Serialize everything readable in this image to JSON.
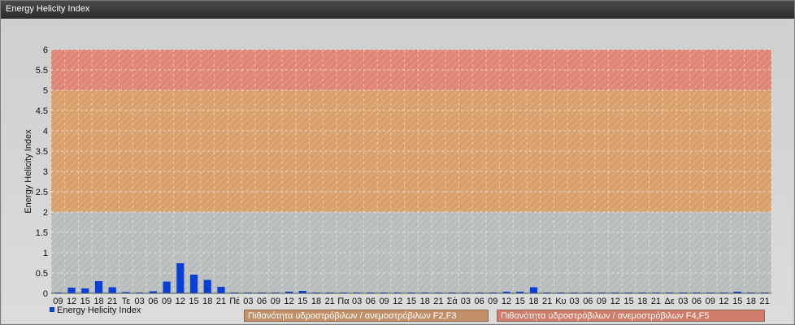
{
  "window": {
    "title": "Energy Helicity Index"
  },
  "colors": {
    "bar": "#0a3fd6",
    "band_low": "#b8bcbc",
    "band_mid": "#d9a06c",
    "band_high": "#de8574"
  },
  "chart_data": {
    "type": "bar",
    "ylabel": "Energy Helicity Index",
    "ylim": [
      0,
      6
    ],
    "yticks": [
      0,
      0.5,
      1,
      1.5,
      2,
      2.5,
      3,
      3.5,
      4,
      4.5,
      5,
      5.5,
      6
    ],
    "grid": true,
    "bands": [
      {
        "from": 2,
        "to": 5,
        "label": "Πιθανότητα υδροστρόβιλων / ανεμοστρόβιλων F2,F3"
      },
      {
        "from": 5,
        "to": 6,
        "label": "Πιθανότητα υδροστρόβιλων / ανεμοστρόβιλων F4,F5"
      }
    ],
    "categories": [
      "09",
      "12",
      "15",
      "18",
      "21",
      "Τε",
      "03",
      "06",
      "09",
      "12",
      "15",
      "18",
      "21",
      "Πέ",
      "03",
      "06",
      "09",
      "12",
      "15",
      "18",
      "21",
      "Πα",
      "03",
      "06",
      "09",
      "12",
      "15",
      "18",
      "21",
      "Σά",
      "03",
      "06",
      "09",
      "12",
      "15",
      "18",
      "21",
      "Κυ",
      "03",
      "06",
      "09",
      "12",
      "15",
      "18",
      "21",
      "Δε",
      "03",
      "06",
      "09",
      "12",
      "15",
      "18",
      "21"
    ],
    "series": [
      {
        "name": "Energy Helicity Index",
        "values": [
          0.01,
          0.14,
          0.12,
          0.3,
          0.15,
          0.03,
          0.02,
          0.05,
          0.29,
          0.74,
          0.46,
          0.33,
          0.16,
          0.01,
          0.01,
          0.01,
          0.01,
          0.04,
          0.06,
          0.01,
          0.01,
          0.01,
          0.01,
          0.01,
          0.01,
          0.01,
          0.01,
          0.01,
          0.01,
          0.01,
          0.01,
          0.01,
          0.01,
          0.04,
          0.04,
          0.15,
          0.02,
          0.01,
          0.01,
          0.01,
          0.01,
          0.01,
          0.01,
          0.02,
          0.01,
          0.01,
          0.01,
          0.02,
          0.01,
          0.02,
          0.04,
          0.01,
          0.01
        ]
      }
    ],
    "legend": "bottom-left"
  }
}
